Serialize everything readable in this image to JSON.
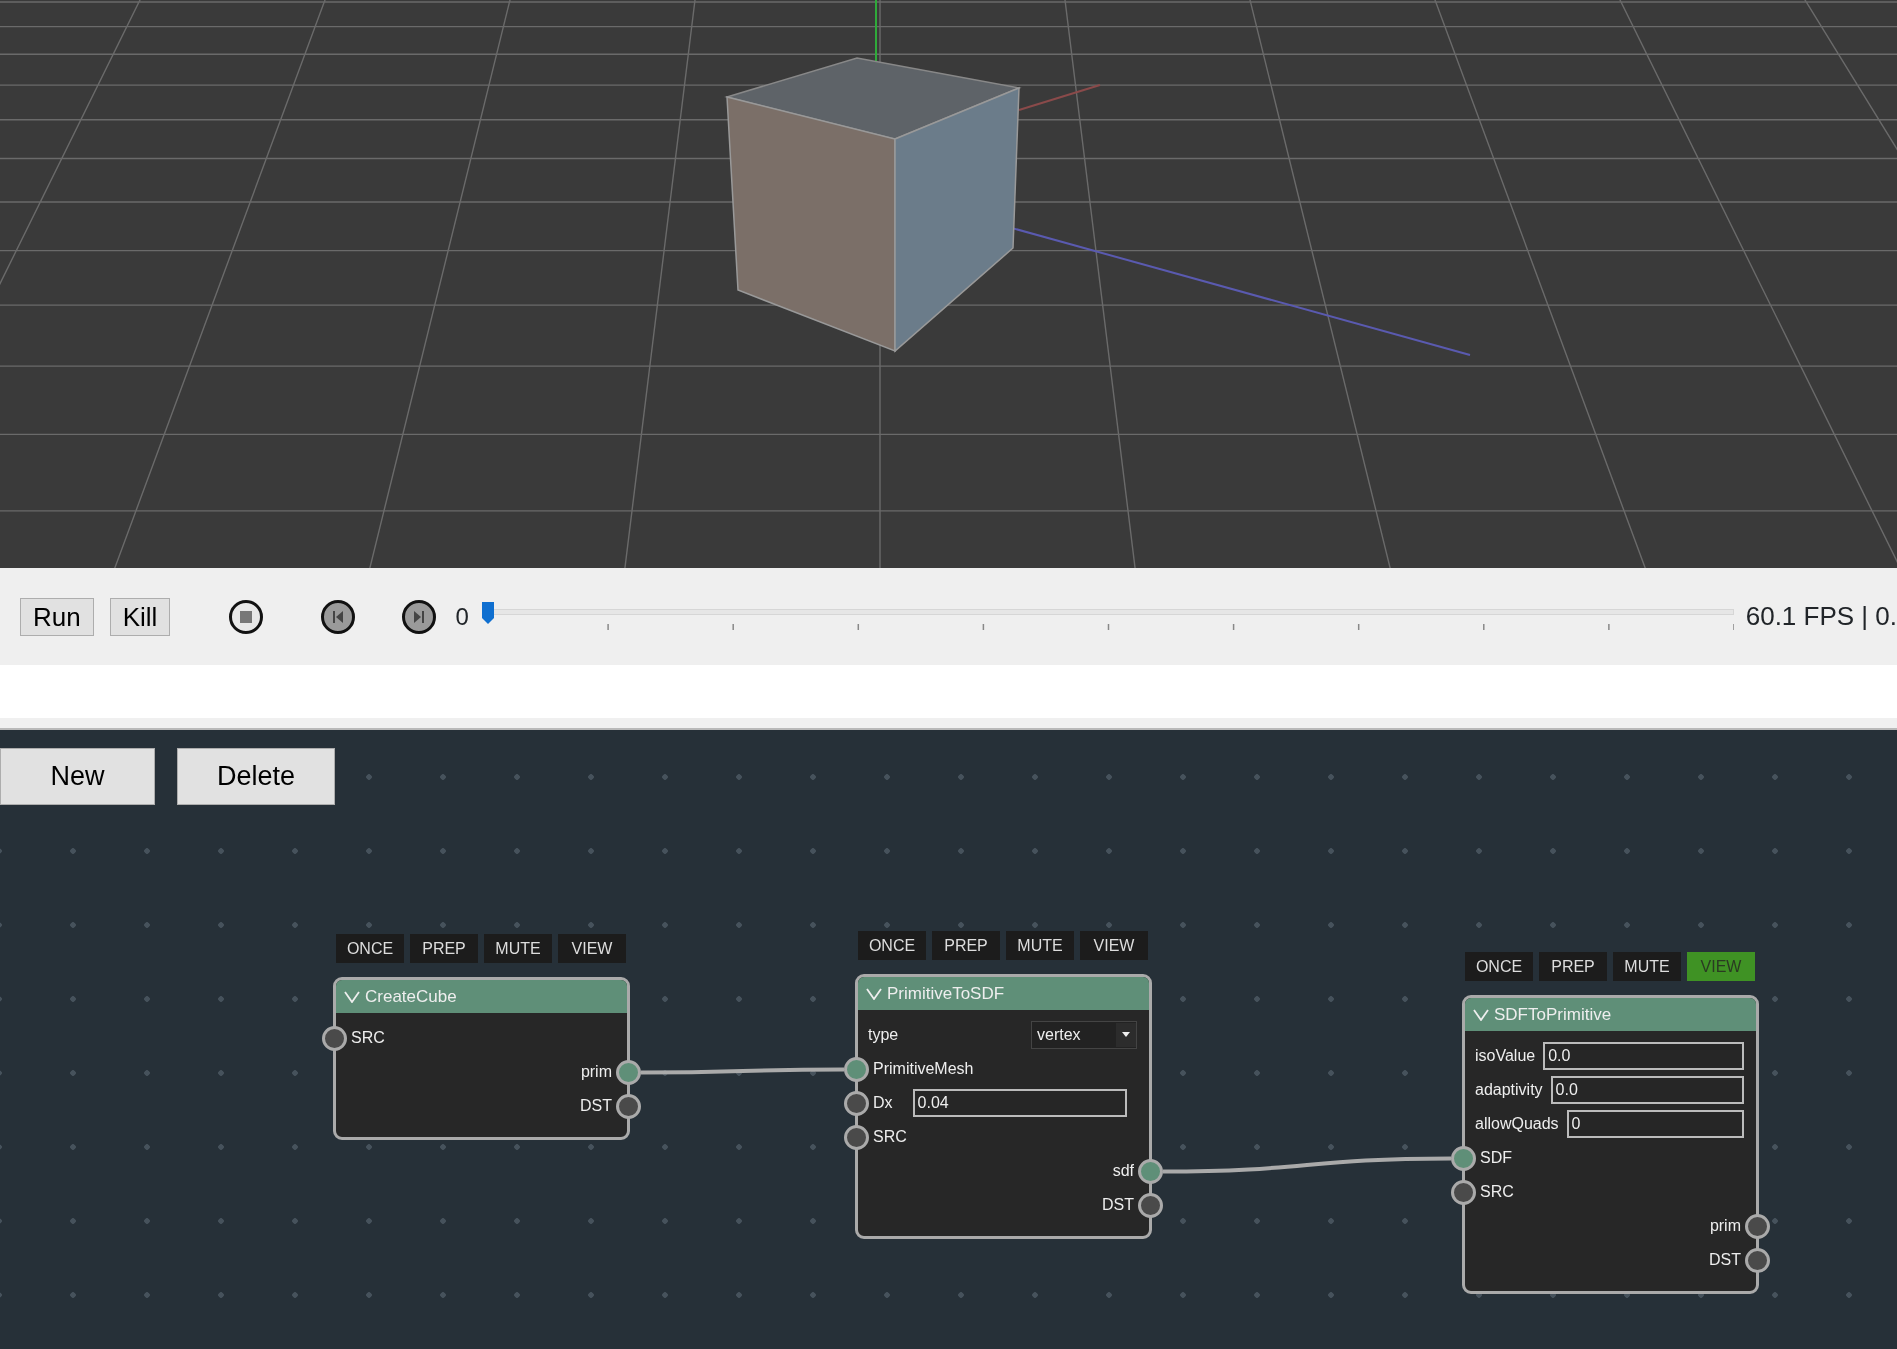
{
  "toolbar": {
    "buttons": [
      "Run",
      "Kill"
    ],
    "frame": "0",
    "timeline": {
      "level": 0
    },
    "fps": "60.1 FPS | 0."
  },
  "editor": {
    "buttons": [
      "New",
      "Delete"
    ],
    "nodes": [
      {
        "title": "CreateCube",
        "expanded": true,
        "flags": [
          {
            "label": "ONCE",
            "on": false
          },
          {
            "label": "PREP",
            "on": false
          },
          {
            "label": "MUTE",
            "on": false
          },
          {
            "label": "VIEW",
            "on": false
          }
        ],
        "rows": [
          {
            "kind": "input",
            "label": "SRC",
            "connected": false
          },
          {
            "kind": "output",
            "label": "prim",
            "connected": true
          },
          {
            "kind": "output",
            "label": "DST",
            "connected": false
          }
        ]
      },
      {
        "title": "PrimitiveToSDF",
        "expanded": true,
        "flags": [
          {
            "label": "ONCE",
            "on": false
          },
          {
            "label": "PREP",
            "on": false
          },
          {
            "label": "MUTE",
            "on": false
          },
          {
            "label": "VIEW",
            "on": false
          }
        ],
        "rows": [
          {
            "kind": "select",
            "label": "type",
            "value": "vertex"
          },
          {
            "kind": "input",
            "label": "PrimitiveMesh",
            "connected": true
          },
          {
            "kind": "input",
            "label": "Dx",
            "connected": false,
            "value": "0.04"
          },
          {
            "kind": "input",
            "label": "SRC",
            "connected": false
          },
          {
            "kind": "output",
            "label": "sdf",
            "connected": true
          },
          {
            "kind": "output",
            "label": "DST",
            "connected": false
          }
        ]
      },
      {
        "title": "SDFToPrimitive",
        "expanded": true,
        "flags": [
          {
            "label": "ONCE",
            "on": false
          },
          {
            "label": "PREP",
            "on": false
          },
          {
            "label": "MUTE",
            "on": false
          },
          {
            "label": "VIEW",
            "on": true
          }
        ],
        "rows": [
          {
            "kind": "param",
            "label": "isoValue",
            "value": "0.0"
          },
          {
            "kind": "param",
            "label": "adaptivity",
            "value": "0.0"
          },
          {
            "kind": "param",
            "label": "allowQuads",
            "value": "0"
          },
          {
            "kind": "input",
            "label": "SDF",
            "connected": true
          },
          {
            "kind": "input",
            "label": "SRC",
            "connected": false
          },
          {
            "kind": "output",
            "label": "prim",
            "connected": false
          },
          {
            "kind": "output",
            "label": "DST",
            "connected": false
          }
        ]
      }
    ]
  }
}
